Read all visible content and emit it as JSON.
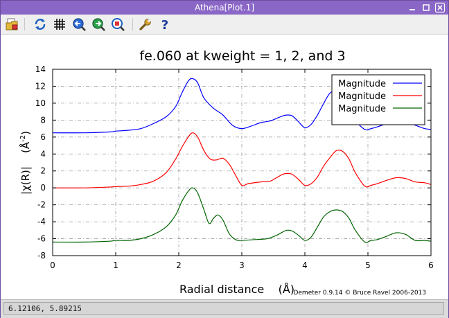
{
  "window": {
    "title": "Athena[Plot.1]"
  },
  "toolbar": {
    "buttons": [
      "open-folder-icon",
      "refresh-icon",
      "grid-icon",
      "zoom-back-icon",
      "zoom-forward-icon",
      "zoom-reset-icon",
      "wrench-icon",
      "help-icon"
    ]
  },
  "status": {
    "coords": "6.12106,  5.89215"
  },
  "credit": "Demeter 0.9.14 © Bruce Ravel 2006-2013",
  "chart_data": {
    "type": "line",
    "title": "fe.060 at kweight = 1, 2, and 3",
    "xlabel": "Radial distance    (Å)",
    "ylabel": "|χ(R)|    (Å",
    "ylabel_exponent": "-2",
    "ylabel_close": ")",
    "xlim": [
      0,
      6
    ],
    "ylim": [
      -8,
      14
    ],
    "xticks": [
      0,
      1,
      2,
      3,
      4,
      5,
      6
    ],
    "yticks": [
      -8,
      -6,
      -4,
      -2,
      0,
      2,
      4,
      6,
      8,
      10,
      12,
      14
    ],
    "grid": true,
    "legend": "top-right",
    "series": [
      {
        "name": "Magnitude",
        "color": "#0000ff",
        "x": [
          0,
          0.5,
          0.9,
          1.0,
          1.2,
          1.4,
          1.6,
          1.8,
          1.95,
          2.05,
          2.15,
          2.22,
          2.3,
          2.4,
          2.55,
          2.7,
          2.85,
          3.0,
          3.15,
          3.3,
          3.45,
          3.55,
          3.65,
          3.72,
          3.8,
          3.9,
          4.0,
          4.1,
          4.2,
          4.3,
          4.4,
          4.5,
          4.6,
          4.7,
          4.8,
          4.95,
          5.05,
          5.15,
          5.3,
          5.45,
          5.6,
          5.75,
          5.9,
          6.0
        ],
        "y": [
          6.5,
          6.5,
          6.6,
          6.7,
          6.8,
          7.0,
          7.6,
          8.4,
          9.6,
          11.2,
          12.6,
          12.9,
          12.4,
          10.6,
          9.4,
          8.6,
          7.4,
          7.0,
          7.3,
          7.7,
          7.9,
          8.2,
          8.5,
          8.6,
          8.5,
          7.8,
          7.1,
          7.5,
          8.6,
          10.0,
          11.2,
          11.4,
          10.8,
          9.6,
          8.0,
          6.9,
          7.0,
          7.2,
          7.6,
          7.9,
          7.8,
          7.4,
          7.0,
          6.9
        ]
      },
      {
        "name": "Magnitude",
        "color": "#ff0000",
        "x": [
          0,
          0.5,
          0.9,
          1.0,
          1.2,
          1.4,
          1.6,
          1.8,
          1.95,
          2.05,
          2.15,
          2.22,
          2.3,
          2.4,
          2.5,
          2.6,
          2.7,
          2.8,
          2.9,
          3.0,
          3.1,
          3.3,
          3.45,
          3.55,
          3.65,
          3.72,
          3.8,
          3.9,
          4.0,
          4.1,
          4.2,
          4.3,
          4.4,
          4.5,
          4.6,
          4.7,
          4.8,
          4.95,
          5.05,
          5.15,
          5.3,
          5.45,
          5.6,
          5.75,
          5.9,
          6.0
        ],
        "y": [
          0.0,
          0.0,
          0.1,
          0.15,
          0.2,
          0.4,
          0.8,
          1.8,
          3.4,
          4.8,
          6.0,
          6.5,
          6.0,
          4.4,
          3.4,
          3.3,
          3.5,
          2.8,
          1.5,
          0.3,
          0.5,
          0.7,
          0.8,
          1.2,
          1.6,
          1.7,
          1.6,
          1.0,
          0.3,
          0.5,
          1.3,
          2.6,
          3.6,
          4.4,
          4.3,
          3.4,
          1.8,
          0.2,
          0.3,
          0.5,
          0.9,
          1.2,
          1.1,
          0.7,
          0.6,
          0.4
        ]
      },
      {
        "name": "Magnitude",
        "color": "#006400",
        "x": [
          0,
          0.5,
          0.9,
          1.0,
          1.2,
          1.4,
          1.6,
          1.8,
          1.95,
          2.05,
          2.15,
          2.22,
          2.3,
          2.4,
          2.48,
          2.55,
          2.62,
          2.7,
          2.8,
          2.9,
          3.0,
          3.2,
          3.4,
          3.55,
          3.65,
          3.72,
          3.8,
          3.9,
          4.0,
          4.1,
          4.2,
          4.3,
          4.4,
          4.5,
          4.6,
          4.7,
          4.8,
          4.95,
          5.05,
          5.15,
          5.3,
          5.45,
          5.6,
          5.75,
          5.9,
          6.0
        ],
        "y": [
          -6.4,
          -6.4,
          -6.3,
          -6.2,
          -6.2,
          -6.0,
          -5.5,
          -4.6,
          -3.2,
          -1.6,
          -0.4,
          0.0,
          -0.6,
          -2.6,
          -4.2,
          -3.6,
          -3.2,
          -3.8,
          -5.4,
          -6.1,
          -6.2,
          -6.1,
          -6.0,
          -5.6,
          -5.2,
          -5.0,
          -5.1,
          -5.6,
          -6.2,
          -5.8,
          -4.6,
          -3.4,
          -2.8,
          -2.6,
          -2.8,
          -3.6,
          -5.0,
          -6.4,
          -6.2,
          -6.1,
          -5.7,
          -5.3,
          -5.5,
          -6.2,
          -6.2,
          -6.3
        ]
      }
    ]
  }
}
